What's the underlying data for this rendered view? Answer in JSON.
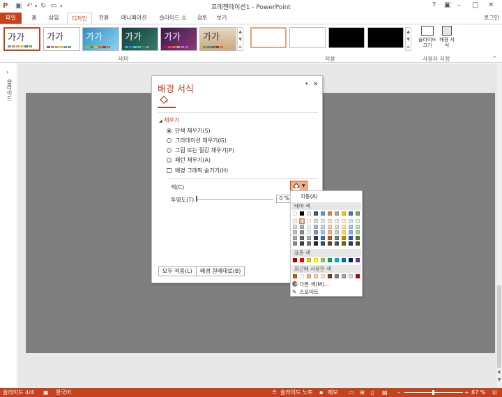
{
  "window": {
    "title": "프레젠테이션1 - PowerPoint",
    "login": "로그인"
  },
  "tabs": [
    {
      "id": "file",
      "label": "파일"
    },
    {
      "id": "home",
      "label": "홈"
    },
    {
      "id": "insert",
      "label": "삽입"
    },
    {
      "id": "design",
      "label": "디자인"
    },
    {
      "id": "transitions",
      "label": "전환"
    },
    {
      "id": "animations",
      "label": "애니메이션"
    },
    {
      "id": "slideshow",
      "label": "슬라이드 쇼"
    },
    {
      "id": "review",
      "label": "검토"
    },
    {
      "id": "view",
      "label": "보기"
    }
  ],
  "ribbon": {
    "themes_label": "테마",
    "variants_label": "적용",
    "custom_label": "사용자 지정",
    "theme_sample_text": "가가",
    "slide_size_label": "슬라이드 크기",
    "format_bg_label": "배경 서식"
  },
  "left_pane": {
    "label": "슬라이드"
  },
  "panel": {
    "title": "배경 서식",
    "section": "채우기",
    "options": {
      "solid": "단색 채우기(S)",
      "gradient": "그라데이션 채우기(G)",
      "picture": "그림 또는 질감 채우기(P)",
      "pattern": "패턴 채우기(A)",
      "hide_graphics": "배경 그래픽 숨기기(H)"
    },
    "color_label": "색(C)",
    "transparency_label": "투명도(T)",
    "transparency_value": "0 %",
    "apply_all": "모두 적용(L)",
    "reset": "배경 원래대로(B)"
  },
  "color_dropdown": {
    "auto": "자동(A)",
    "theme_colors": "테마 색",
    "standard_colors": "표준 색",
    "recent_colors": "최근에 사용한 색",
    "more_colors": "다른 색(M)...",
    "eyedropper": "스포이트",
    "theme_top_colors": [
      "#ffffff",
      "#000000",
      "#e7e6e6",
      "#44546a",
      "#5b9bd5",
      "#ed7d31",
      "#a5a5a5",
      "#ffc000",
      "#4472c4",
      "#70ad47"
    ],
    "standard": [
      "#c00000",
      "#ff0000",
      "#ffc000",
      "#ffff00",
      "#92d050",
      "#00b050",
      "#00b0f0",
      "#0070c0",
      "#002060",
      "#7030a0"
    ],
    "recent": [
      "#c55a11",
      "#ffffff",
      "#f4b183",
      "#f8cbad",
      "#fbe5d6",
      "#843c0c",
      "#7f7f7f",
      "#a6a6a6",
      "#d9d9d9",
      "#c00000"
    ]
  },
  "status": {
    "slide": "슬라이드 4/4",
    "language": "한국어",
    "notes": "슬라이드 노트",
    "comments": "메모",
    "zoom": "87 %"
  },
  "colors": {
    "accent": "#c5421d",
    "slide_bg": "#7f7f7f"
  }
}
